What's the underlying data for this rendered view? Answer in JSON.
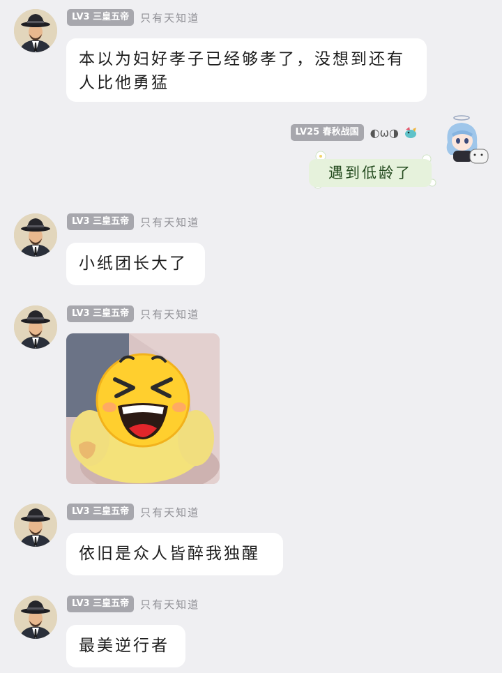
{
  "messages": [
    {
      "badge": "LV3 三皇五帝",
      "nick": "只有天知道",
      "text": "本以为妇好孝子已经够孝了，没想到还有人比他勇猛"
    },
    {
      "badge": "LV25 春秋战国",
      "nick": "◐ω◑",
      "text": "遇到低龄了"
    },
    {
      "badge": "LV3 三皇五帝",
      "nick": "只有天知道",
      "text": "小纸团长大了"
    },
    {
      "badge": "LV3 三皇五帝",
      "nick": "只有天知道",
      "image": "laughing-emoji-sticker"
    },
    {
      "badge": "LV3 三皇五帝",
      "nick": "只有天知道",
      "text": "依旧是众人皆醉我独醒"
    },
    {
      "badge": "LV3 三皇五帝",
      "nick": "只有天知道",
      "text": "最美逆行者"
    }
  ],
  "colors": {
    "background": "#efeff2",
    "bubble": "#ffffff",
    "badge": "#a7a7ad",
    "green_bubble": "#e6f2dc"
  }
}
